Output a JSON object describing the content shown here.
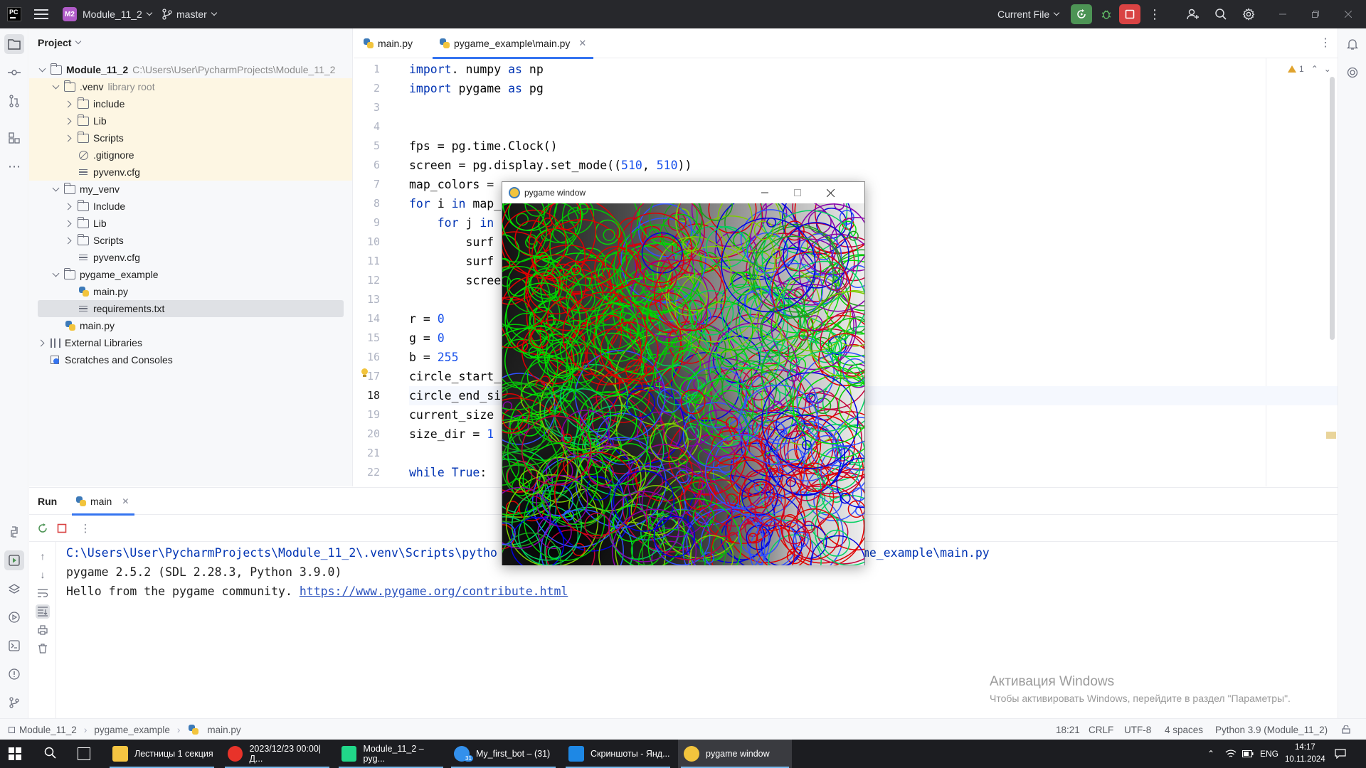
{
  "titlebar": {
    "logo_text": "PC",
    "project_badge": "M2",
    "project_name": "Module_11_2",
    "branch": "master",
    "run_config": "Current File"
  },
  "project_panel": {
    "title": "Project",
    "tree": [
      {
        "label": "Module_11_2",
        "hint": "C:\\Users\\User\\PycharmProjects\\Module_11_2",
        "depth": 0,
        "arrow": "down",
        "icon": "folder",
        "bold": true,
        "hl": false
      },
      {
        "label": ".venv",
        "hint": "library root",
        "depth": 1,
        "arrow": "down",
        "icon": "folder",
        "hl": true
      },
      {
        "label": "include",
        "hint": "",
        "depth": 2,
        "arrow": "right",
        "icon": "folder",
        "hl": true
      },
      {
        "label": "Lib",
        "hint": "",
        "depth": 2,
        "arrow": "right",
        "icon": "folder",
        "hl": true
      },
      {
        "label": "Scripts",
        "hint": "",
        "depth": 2,
        "arrow": "right",
        "icon": "folder",
        "hl": true
      },
      {
        "label": ".gitignore",
        "hint": "",
        "depth": 2,
        "arrow": "none",
        "icon": "ignore",
        "hl": true
      },
      {
        "label": "pyvenv.cfg",
        "hint": "",
        "depth": 2,
        "arrow": "none",
        "icon": "file",
        "hl": true
      },
      {
        "label": "my_venv",
        "hint": "",
        "depth": 1,
        "arrow": "down",
        "icon": "folder",
        "hl": false
      },
      {
        "label": "Include",
        "hint": "",
        "depth": 2,
        "arrow": "right",
        "icon": "folder",
        "hl": false
      },
      {
        "label": "Lib",
        "hint": "",
        "depth": 2,
        "arrow": "right",
        "icon": "folder",
        "hl": false
      },
      {
        "label": "Scripts",
        "hint": "",
        "depth": 2,
        "arrow": "right",
        "icon": "folder",
        "hl": false
      },
      {
        "label": "pyvenv.cfg",
        "hint": "",
        "depth": 2,
        "arrow": "none",
        "icon": "file",
        "hl": false
      },
      {
        "label": "pygame_example",
        "hint": "",
        "depth": 1,
        "arrow": "down",
        "icon": "folder",
        "hl": false
      },
      {
        "label": "main.py",
        "hint": "",
        "depth": 2,
        "arrow": "none",
        "icon": "python",
        "hl": false
      },
      {
        "label": "requirements.txt",
        "hint": "",
        "depth": 2,
        "arrow": "none",
        "icon": "file",
        "hl": false,
        "selected": true
      },
      {
        "label": "main.py",
        "hint": "",
        "depth": 1,
        "arrow": "none",
        "icon": "python",
        "hl": false
      },
      {
        "label": "External Libraries",
        "hint": "",
        "depth": 0,
        "arrow": "right",
        "icon": "library",
        "hl": false
      },
      {
        "label": "Scratches and Consoles",
        "hint": "",
        "depth": 0,
        "arrow": "none",
        "icon": "scratch",
        "hl": false
      }
    ]
  },
  "editor": {
    "tabs": [
      {
        "label": "main.py",
        "active": false
      },
      {
        "label": "pygame_example\\main.py",
        "active": true
      }
    ],
    "warning_count": "1",
    "current_line": 18,
    "lines": [
      {
        "n": "1",
        "code": [
          [
            "kw",
            "import"
          ],
          [
            "",
            ". numpy "
          ],
          [
            "kw",
            "as"
          ],
          [
            "",
            " np"
          ]
        ]
      },
      {
        "n": "2",
        "code": [
          [
            "kw",
            "import"
          ],
          [
            "",
            " pygame "
          ],
          [
            "kw",
            "as"
          ],
          [
            "",
            " pg"
          ]
        ]
      },
      {
        "n": "3",
        "code": []
      },
      {
        "n": "4",
        "code": []
      },
      {
        "n": "5",
        "code": [
          [
            "",
            "fps = pg.time.Clock()"
          ]
        ]
      },
      {
        "n": "6",
        "code": [
          [
            "",
            "screen = pg.display.set_mode(("
          ],
          [
            "num",
            "510"
          ],
          [
            "",
            ", "
          ],
          [
            "num",
            "510"
          ],
          [
            "",
            "))"
          ]
        ]
      },
      {
        "n": "7",
        "code": [
          [
            "",
            "map_colors = "
          ]
        ]
      },
      {
        "n": "8",
        "code": [
          [
            "kw",
            "for"
          ],
          [
            "",
            " i "
          ],
          [
            "kw",
            "in"
          ],
          [
            "",
            " map_"
          ]
        ]
      },
      {
        "n": "9",
        "code": [
          [
            "",
            "    "
          ],
          [
            "kw",
            "for"
          ],
          [
            "",
            " j "
          ],
          [
            "kw",
            "in"
          ]
        ]
      },
      {
        "n": "10",
        "code": [
          [
            "",
            "        surf"
          ]
        ]
      },
      {
        "n": "11",
        "code": [
          [
            "",
            "        surf"
          ]
        ]
      },
      {
        "n": "12",
        "code": [
          [
            "",
            "        scree"
          ]
        ]
      },
      {
        "n": "13",
        "code": []
      },
      {
        "n": "14",
        "code": [
          [
            "",
            "r = "
          ],
          [
            "num",
            "0"
          ]
        ]
      },
      {
        "n": "15",
        "code": [
          [
            "",
            "g = "
          ],
          [
            "num",
            "0"
          ]
        ]
      },
      {
        "n": "16",
        "code": [
          [
            "",
            "b = "
          ],
          [
            "num",
            "255"
          ]
        ]
      },
      {
        "n": "17",
        "code": [
          [
            "",
            "circle_start_"
          ]
        ]
      },
      {
        "n": "18",
        "code": [
          [
            "",
            "circle_end_si"
          ]
        ]
      },
      {
        "n": "19",
        "code": [
          [
            "",
            "current_size"
          ]
        ]
      },
      {
        "n": "20",
        "code": [
          [
            "",
            "size_dir = "
          ],
          [
            "num",
            "1"
          ]
        ]
      },
      {
        "n": "21",
        "code": []
      },
      {
        "n": "22",
        "code": [
          [
            "kw",
            "while"
          ],
          [
            "",
            " "
          ],
          [
            "kw",
            "True"
          ],
          [
            "",
            ":"
          ]
        ]
      }
    ]
  },
  "pygame_window": {
    "title": "pygame window",
    "colors": [
      "#00e000",
      "#00c800",
      "#e00000",
      "#0000e0",
      "#1a9e1a",
      "#8800aa",
      "#c4003a",
      "#00d060",
      "#3050ff",
      "#7fcc00"
    ]
  },
  "run_panel": {
    "title": "Run",
    "tab_label": "main",
    "console": {
      "line1_a": "C:\\Users\\User\\PycharmProjects\\Module_11_2\\.venv\\Scripts\\pytho",
      "line1_b": "ame_example\\main.py",
      "line2": "pygame 2.5.2 (SDL 2.28.3, Python 3.9.0)",
      "line3_text": "Hello from the pygame community. ",
      "line3_link": "https://www.pygame.org/contribute.html"
    },
    "activation_title": "Активация Windows",
    "activation_sub": "Чтобы активировать Windows, перейдите в раздел \"Параметры\"."
  },
  "statusbar": {
    "crumbs": [
      "Module_11_2",
      "pygame_example",
      "main.py"
    ],
    "position": "18:21",
    "line_sep": "CRLF",
    "encoding": "UTF-8",
    "indent": "4 spaces",
    "interpreter": "Python 3.9 (Module_11_2)"
  },
  "taskbar": {
    "apps": [
      {
        "label": "Лестницы 1 секция",
        "icon_color": "#f5c542"
      },
      {
        "label": "2023/12/23 00:00|Д...",
        "icon_color": "#e8332a"
      },
      {
        "label": "Module_11_2 – pyg...",
        "icon_color": "#21d789"
      },
      {
        "label": "My_first_bot – (31)",
        "icon_color": "#3390ec"
      },
      {
        "label": "Скриншоты - Янд...",
        "icon_color": "#1e88e5"
      },
      {
        "label": "pygame window",
        "icon_color": "#f2c43d",
        "active": true
      }
    ],
    "lang": "ENG",
    "time": "14:17",
    "date": "10.11.2024",
    "badge": "31"
  }
}
